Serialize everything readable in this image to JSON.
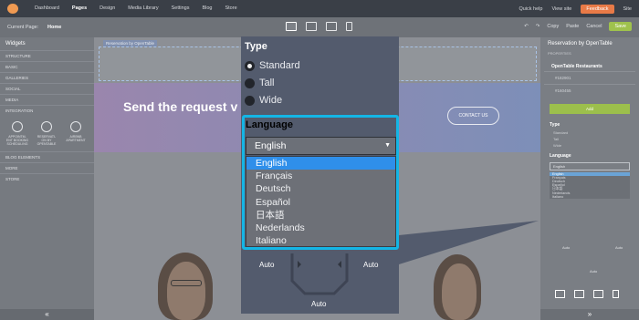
{
  "topbar": {
    "nav": [
      "Dashboard",
      "Pages",
      "Design",
      "Media Library",
      "Settings",
      "Blog",
      "Store"
    ],
    "active": "Pages",
    "right": [
      "Quick help",
      "View site"
    ],
    "feedback": "Feedback",
    "user": "Site"
  },
  "subbar": {
    "current_page_label": "Current Page:",
    "current_page": "Home",
    "copy": "Copy",
    "paste": "Paste",
    "cancel": "Cancel",
    "save": "Save"
  },
  "left": {
    "title": "Widgets",
    "categories": [
      "STRUCTURE",
      "BASIC",
      "GALLERIES",
      "SOCIAL",
      "MEDIA",
      "INTEGRATION"
    ],
    "integrations": [
      "APPOINTM- ENT BOOKING SCHEDULING",
      "RESERVATI- ON BY OPENTABLE",
      "AIRBNB APARTMENT"
    ],
    "more_categories": [
      "BLOG ELEMENTS",
      "MORE",
      "STORE"
    ]
  },
  "canvas": {
    "widget_label": "Reservation by OpenTable",
    "hero_heading": "Send the request v",
    "contact_button": "CONTACT US"
  },
  "popup": {
    "type_heading": "Type",
    "types": [
      "Standard",
      "Tall",
      "Wide"
    ],
    "selected_type": "Standard",
    "language_heading": "Language",
    "selected_language": "English",
    "languages": [
      "English",
      "Français",
      "Deutsch",
      "Español",
      "日本語",
      "Nederlands",
      "Italiano"
    ],
    "auto_labels": [
      "Auto",
      "Auto",
      "Auto"
    ]
  },
  "right": {
    "title": "Reservation by OpenTable",
    "properties": "PROPERTIES",
    "restaurants_heading": "OpenTable Restaurants",
    "restaurants": [
      "#182901",
      "#160455"
    ],
    "add_button": "Add",
    "type_heading": "Type",
    "types": [
      "Standard",
      "Tall",
      "Wide"
    ],
    "language_heading": "Language",
    "selected_language": "English",
    "languages": [
      "English",
      "Français",
      "Deutsch",
      "Español",
      "日本語",
      "Nederlands",
      "Italiano"
    ],
    "auto_labels": [
      "Auto",
      "Auto",
      "Auto"
    ]
  },
  "colors": {
    "accent": "#14b5e5",
    "selected_option": "#2f8fea",
    "save": "#9fc24d",
    "feedback": "#e87a47"
  }
}
